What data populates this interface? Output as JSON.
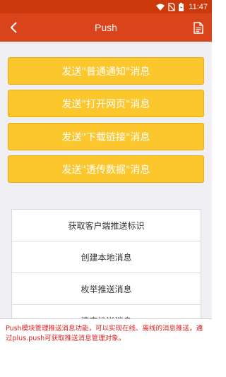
{
  "status_bar": {
    "time": "11:47",
    "icons": [
      "wifi-icon",
      "no-sim-icon",
      "battery-icon"
    ]
  },
  "header": {
    "title": "Push",
    "back_icon": "back-chevron-icon",
    "right_icon": "document-icon"
  },
  "actions": [
    {
      "label": "发送\"普通通知\"消息"
    },
    {
      "label": "发送\"打开网页\"消息"
    },
    {
      "label": "发送\"下载链接\"消息"
    },
    {
      "label": "发送\"透传数据\"消息"
    }
  ],
  "list_items": [
    {
      "label": "获取客户端推送标识"
    },
    {
      "label": "创建本地消息"
    },
    {
      "label": "枚举推送消息"
    },
    {
      "label": "清空推送消息"
    }
  ],
  "info_text": "Push模块管理推送消息功能，可以实现在线、离线的消息推送，通过plus.push可获取推送消息管理对象。",
  "colors": {
    "status_bar": "#cc3a0b",
    "header": "#d9441a",
    "button": "#fcc62d",
    "info_text": "#e02020"
  }
}
